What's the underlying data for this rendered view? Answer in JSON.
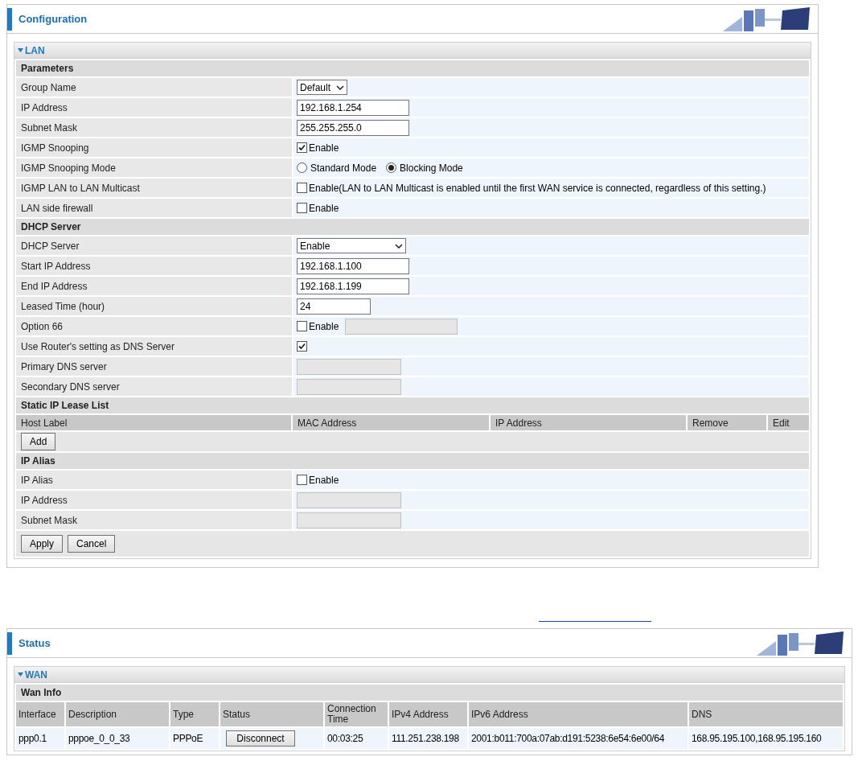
{
  "config": {
    "title": "Configuration",
    "panel": {
      "title": "LAN",
      "expanded": true,
      "rows": [
        {
          "kind": "section",
          "label": "Parameters"
        },
        {
          "kind": "select",
          "label": "Group Name",
          "value": "Default"
        },
        {
          "kind": "text",
          "label": "IP Address",
          "value": "192.168.1.254"
        },
        {
          "kind": "text",
          "label": "Subnet Mask",
          "value": "255.255.255.0"
        },
        {
          "kind": "checkbox",
          "label": "IGMP Snooping",
          "checked": true,
          "text": "Enable"
        },
        {
          "kind": "radio",
          "label": "IGMP Snooping Mode",
          "options": [
            {
              "label": "Standard Mode",
              "selected": false
            },
            {
              "label": "Blocking Mode",
              "selected": true
            }
          ]
        },
        {
          "kind": "checkbox",
          "label": "IGMP LAN to LAN Multicast",
          "checked": false,
          "text": "Enable(LAN to LAN Multicast is enabled until the first WAN service is connected, regardless of this setting.)"
        },
        {
          "kind": "checkbox",
          "label": "LAN side firewall",
          "checked": false,
          "text": "Enable"
        },
        {
          "kind": "section",
          "label": "DHCP Server"
        },
        {
          "kind": "select",
          "label": "DHCP Server",
          "value": "Enable"
        },
        {
          "kind": "text",
          "label": "Start IP Address",
          "value": "192.168.1.100"
        },
        {
          "kind": "text",
          "label": "End IP Address",
          "value": "192.168.1.199"
        },
        {
          "kind": "text",
          "label": "Leased Time (hour)",
          "value": "24"
        },
        {
          "kind": "checkbox_input",
          "label": "Option 66",
          "checked": false,
          "text": "Enable"
        },
        {
          "kind": "checkbox",
          "label": "Use Router's setting as DNS Server",
          "checked": true
        },
        {
          "kind": "disabled_input",
          "label": "Primary DNS server"
        },
        {
          "kind": "disabled_input",
          "label": "Secondary DNS server"
        },
        {
          "kind": "section",
          "label": "Static IP Lease List"
        },
        {
          "kind": "table_header",
          "columns": [
            "Host Label",
            "MAC Address",
            "IP Address",
            "Remove",
            "Edit"
          ]
        },
        {
          "kind": "button",
          "label": "Add"
        },
        {
          "kind": "section",
          "label": "IP Alias"
        },
        {
          "kind": "checkbox",
          "label": "IP Alias",
          "checked": false,
          "text": "Enable"
        },
        {
          "kind": "disabled_input",
          "label": "IP Address"
        },
        {
          "kind": "disabled_input",
          "label": "Subnet Mask"
        }
      ],
      "buttons": [
        "Apply",
        "Cancel"
      ]
    }
  },
  "status": {
    "title": "Status",
    "panel": {
      "title": "WAN",
      "expanded": true,
      "section": "Wan Info",
      "columns": [
        "Interface",
        "Description",
        "Type",
        "Status",
        "Connection Time",
        "IPv4 Address",
        "IPv6 Address",
        "DNS"
      ],
      "rows": [
        {
          "cells": [
            {
              "kind": "text",
              "text": "ppp0.1"
            },
            {
              "kind": "text",
              "text": "pppoe_0_0_33"
            },
            {
              "kind": "text",
              "text": "PPPoE"
            },
            {
              "kind": "button",
              "text": "Disconnect"
            },
            {
              "kind": "text",
              "text": "00:03:25"
            },
            {
              "kind": "text",
              "text": "111.251.238.198"
            },
            {
              "kind": "text",
              "text": "2001:b011:700a:07ab:d191:5238:6e54:6e00/64"
            },
            {
              "kind": "text",
              "text": "168.95.195.100,168.95.195.160"
            }
          ]
        }
      ]
    }
  }
}
